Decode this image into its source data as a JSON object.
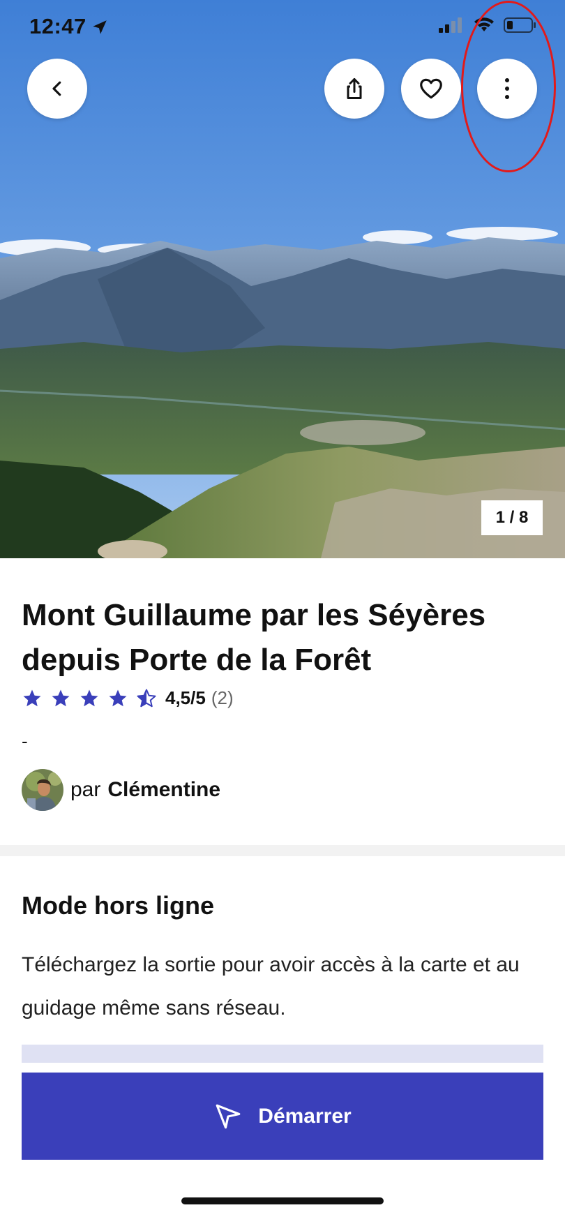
{
  "status_bar": {
    "time": "12:47"
  },
  "photo": {
    "counter": "1 / 8"
  },
  "route": {
    "title": "Mont Guillaume par les Séyères depuis Porte de la Forêt",
    "rating_value": "4,5/5",
    "rating_count": "(2)",
    "rating_stars": 4.5,
    "dash": "-",
    "author_prefix": "par",
    "author_name": "Clémentine"
  },
  "offline": {
    "title": "Mode hors ligne",
    "description": "Téléchargez la sortie pour avoir accès à la carte et au guidage même sans réseau."
  },
  "actions": {
    "start_label": "Démarrer"
  },
  "colors": {
    "accent": "#3a3fba",
    "star": "#3a3fba",
    "highlight": "#e21a1a",
    "offline_panel": "#dfe1f3"
  },
  "icons": [
    "back-chevron-icon",
    "share-icon",
    "heart-icon",
    "more-vertical-icon",
    "navigation-arrow-icon",
    "location-arrow-icon",
    "signal-icon",
    "wifi-icon",
    "battery-icon",
    "star-icon"
  ]
}
